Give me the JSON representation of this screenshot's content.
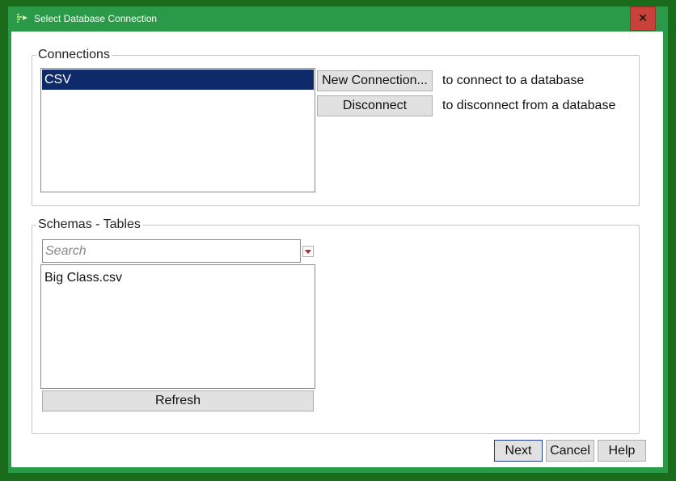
{
  "window": {
    "title": "Select Database Connection",
    "close_glyph": "✕"
  },
  "connections": {
    "legend": "Connections",
    "items": [
      {
        "label": "CSV",
        "selected": true
      }
    ],
    "new_connection_button": "New Connection...",
    "new_connection_hint": "to connect to a database",
    "disconnect_button": "Disconnect",
    "disconnect_hint": "to disconnect from a database"
  },
  "schemas": {
    "legend": "Schemas - Tables",
    "search_placeholder": "Search",
    "search_value": "",
    "items": [
      {
        "label": "Big Class.csv"
      }
    ],
    "refresh_button": "Refresh"
  },
  "footer": {
    "next_button": "Next",
    "cancel_button": "Cancel",
    "help_button": "Help"
  },
  "colors": {
    "title_bar": "#2a9a48",
    "close_button": "#c8423b",
    "selection": "#0f2a6b",
    "dropdown_arrow": "#c41e1e"
  },
  "icons": {
    "app": "jmp-app-icon",
    "close": "close-icon",
    "search_menu": "chevron-down-icon"
  }
}
